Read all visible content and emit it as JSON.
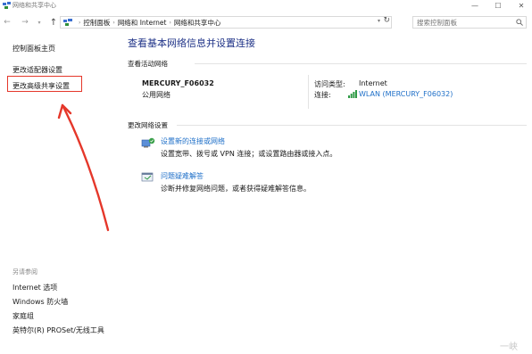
{
  "window": {
    "title": "网络和共享中心",
    "controls": {
      "minimize": "—",
      "maximize": "☐",
      "close": "✕"
    }
  },
  "nav": {
    "back_icon": "arrow-left-icon",
    "forward_icon": "arrow-right-icon",
    "up_icon": "arrow-up-icon",
    "breadcrumbs": [
      "控制面板",
      "网络和 Internet",
      "网络和共享中心"
    ],
    "search_placeholder": "搜索控制面板"
  },
  "sidebar": {
    "links": [
      "控制面板主页",
      "更改适配器设置",
      "更改高级共享设置"
    ],
    "see_also_label": "另请参阅",
    "see_also_links": [
      "Internet 选项",
      "Windows 防火墙",
      "家庭组",
      "英特尔(R) PROSet/无线工具"
    ]
  },
  "main": {
    "title": "查看基本网络信息并设置连接",
    "active_networks_label": "查看活动网络",
    "network": {
      "name": "MERCURY_F06032",
      "type": "公用网络",
      "access_type_label": "访问类型:",
      "access_type_value": "Internet",
      "connection_label": "连接:",
      "connection_value": "WLAN (MERCURY_F06032)"
    },
    "change_settings_label": "更改网络设置",
    "tasks": [
      {
        "link": "设置新的连接或网络",
        "description": "设置宽带、拨号或 VPN 连接；或设置路由器或接入点。"
      },
      {
        "link": "问题疑难解答",
        "description": "诊断并修复网络问题，或者获得疑难解答信息。"
      }
    ]
  },
  "watermark": "一峡",
  "colors": {
    "title_blue": "#1e3287",
    "link_blue": "#1e6fc8",
    "annotation_red": "#e5372a"
  }
}
